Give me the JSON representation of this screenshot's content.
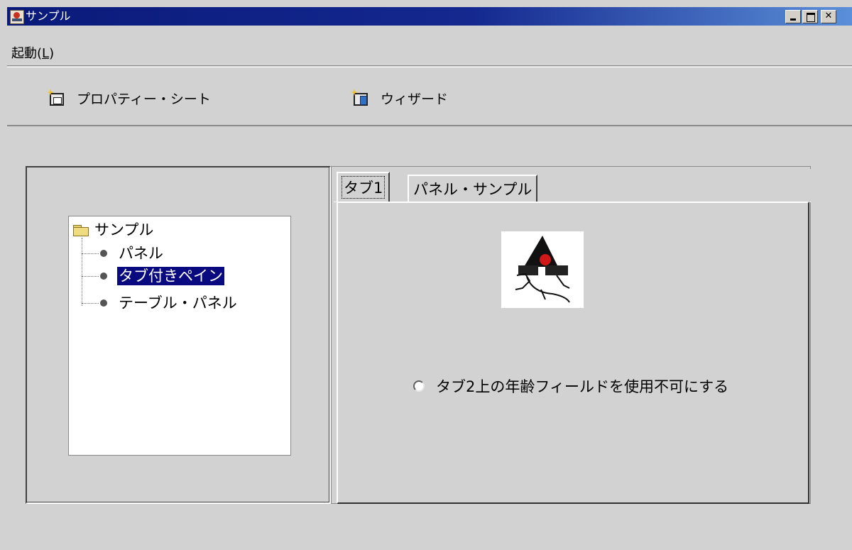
{
  "window": {
    "title": "サンプル",
    "controls": [
      "minimize",
      "maximize",
      "close"
    ]
  },
  "menubar": {
    "items": [
      {
        "label_pre": "起動(",
        "mnemonic": "L",
        "label_post": ")"
      }
    ]
  },
  "toolbar": {
    "buttons": [
      {
        "label": "プロパティー・シート",
        "icon": "property-sheet-icon"
      },
      {
        "label": "ウィザード",
        "icon": "wizard-icon"
      }
    ]
  },
  "tree": {
    "root": {
      "label": "サンプル",
      "icon": "folder-icon"
    },
    "nodes": [
      {
        "label": "パネル",
        "selected": false
      },
      {
        "label": "タブ付きペイン",
        "selected": true
      },
      {
        "label": "テーブル・パネル",
        "selected": false
      }
    ]
  },
  "tabs": [
    {
      "label": "タブ1",
      "active": true
    },
    {
      "label": "パネル・サンプル",
      "active": false
    }
  ],
  "tab_content": {
    "image": "duke-mascot",
    "radio": {
      "label": "タブ2上の年齢フィールドを使用不可にする",
      "checked": false
    }
  },
  "colors": {
    "title_bar": "#0a1a7a",
    "selection": "#0a0a80",
    "background": "#d2d2d2"
  }
}
